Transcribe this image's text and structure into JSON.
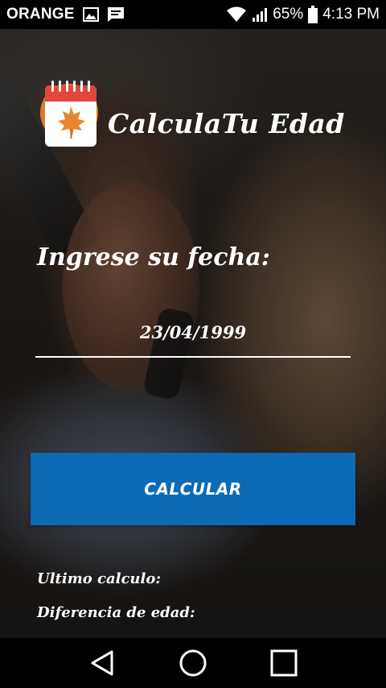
{
  "status_bar": {
    "carrier": "ORANGE",
    "battery": "65%",
    "time": "4:13 PM",
    "icons": [
      "image-icon",
      "message-icon",
      "wifi-icon",
      "signal-icon",
      "battery-icon"
    ]
  },
  "header": {
    "app_title": "CalculaTu Edad",
    "logo_icon": "calendar-leaf-icon"
  },
  "form": {
    "date_label": "Ingrese su fecha:",
    "date_value": "23/04/1999"
  },
  "calc_button": {
    "label": "CALCULAR"
  },
  "results": {
    "last_calc_label": "Ultimo calculo:",
    "age_diff_label": "Diferencia de edad:"
  },
  "nav_bar": {
    "icons": [
      "back-icon",
      "home-icon",
      "recents-icon"
    ]
  },
  "colors": {
    "button": "#0b6ab5",
    "calendar_red": "#e2463d",
    "leaf_orange": "#e8862e"
  }
}
